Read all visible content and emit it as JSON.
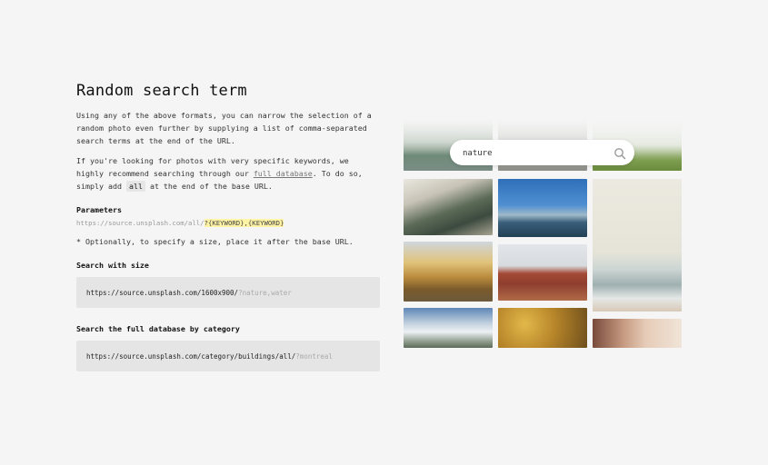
{
  "section": {
    "title": "Random search term",
    "paragraph1": "Using any of the above formats, you can narrow the selection of a random photo even further by supplying a list of comma-separated search terms at the end of the URL.",
    "paragraph2_part1": "If you're looking for photos with very specific keywords, we highly recommend searching through our ",
    "paragraph2_link": "full database",
    "paragraph2_part2": ". To do so, simply add ",
    "paragraph2_code": "all",
    "paragraph2_part3": " at the end of the base URL."
  },
  "parameters": {
    "heading": "Parameters",
    "base_url": "https://source.unsplash.com/all/",
    "keyword_template": "?{KEYWORD},{KEYWORD}",
    "note": "* Optionally, to specify a size, place it after the base URL."
  },
  "search_with_size": {
    "heading": "Search with size",
    "url_base": "https://source.unsplash.com/1600x900/",
    "url_query": "?nature,water"
  },
  "search_by_category": {
    "heading": "Search the full database by category",
    "url_base": "https://source.unsplash.com/category/buildings/all/",
    "url_query": "?montreal"
  },
  "demo_search": {
    "value": "nature",
    "icon": "search-icon"
  },
  "colors": {
    "background": "#f5f5f5",
    "code_background": "#e5e5e5",
    "keyword_highlight": "#fff3a6"
  }
}
